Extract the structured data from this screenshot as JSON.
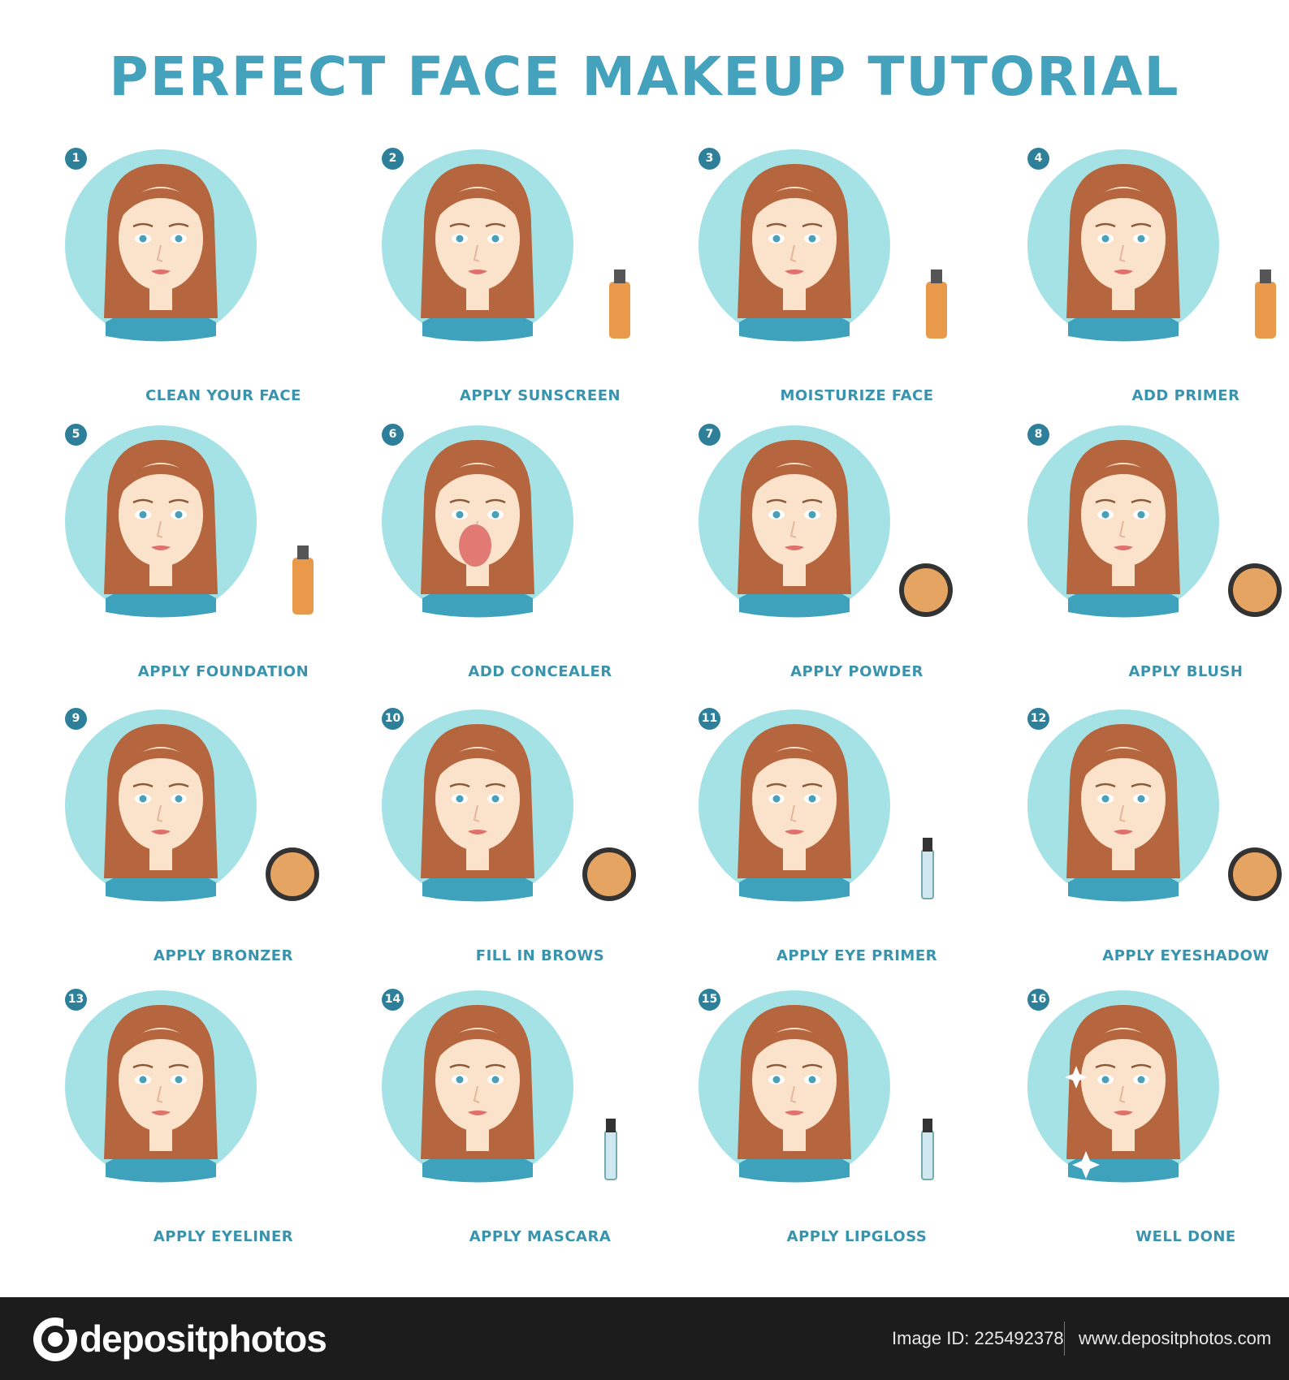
{
  "title": "PERFECT FACE MAKEUP TUTORIAL",
  "colors": {
    "accent": "#44a2bd",
    "badge": "#2e7f99",
    "circle": "#a5e2e6",
    "hair": "#b5663e",
    "skin": "#fbe3cb",
    "shirt": "#3fa2bd",
    "footer_bg": "#1c1c1c"
  },
  "steps": [
    {
      "number": "1",
      "label": "CLEAN YOUR FACE",
      "product": "none"
    },
    {
      "number": "2",
      "label": "APPLY SUNSCREEN",
      "product": "bottle"
    },
    {
      "number": "3",
      "label": "MOISTURIZE FACE",
      "product": "bottle"
    },
    {
      "number": "4",
      "label": "ADD PRIMER",
      "product": "bottle"
    },
    {
      "number": "5",
      "label": "APPLY FOUNDATION",
      "product": "bottle"
    },
    {
      "number": "6",
      "label": "ADD CONCEALER",
      "product": "sponge"
    },
    {
      "number": "7",
      "label": "APPLY POWDER",
      "product": "compact"
    },
    {
      "number": "8",
      "label": "APPLY BLUSH",
      "product": "compact"
    },
    {
      "number": "9",
      "label": "APPLY BRONZER",
      "product": "compact"
    },
    {
      "number": "10",
      "label": "FILL IN BROWS",
      "product": "compact"
    },
    {
      "number": "11",
      "label": "APPLY EYE PRIMER",
      "product": "tube"
    },
    {
      "number": "12",
      "label": "APPLY EYESHADOW",
      "product": "compact"
    },
    {
      "number": "13",
      "label": "APPLY EYELINER",
      "product": "none"
    },
    {
      "number": "14",
      "label": "APPLY MASCARA",
      "product": "tube"
    },
    {
      "number": "15",
      "label": "APPLY LIPGLOSS",
      "product": "tube"
    },
    {
      "number": "16",
      "label": "WELL DONE",
      "product": "sparkles"
    }
  ],
  "footer": {
    "logo_text": "depositphotos",
    "image_id": "Image ID: 225492378",
    "site_url": "www.depositphotos.com"
  }
}
